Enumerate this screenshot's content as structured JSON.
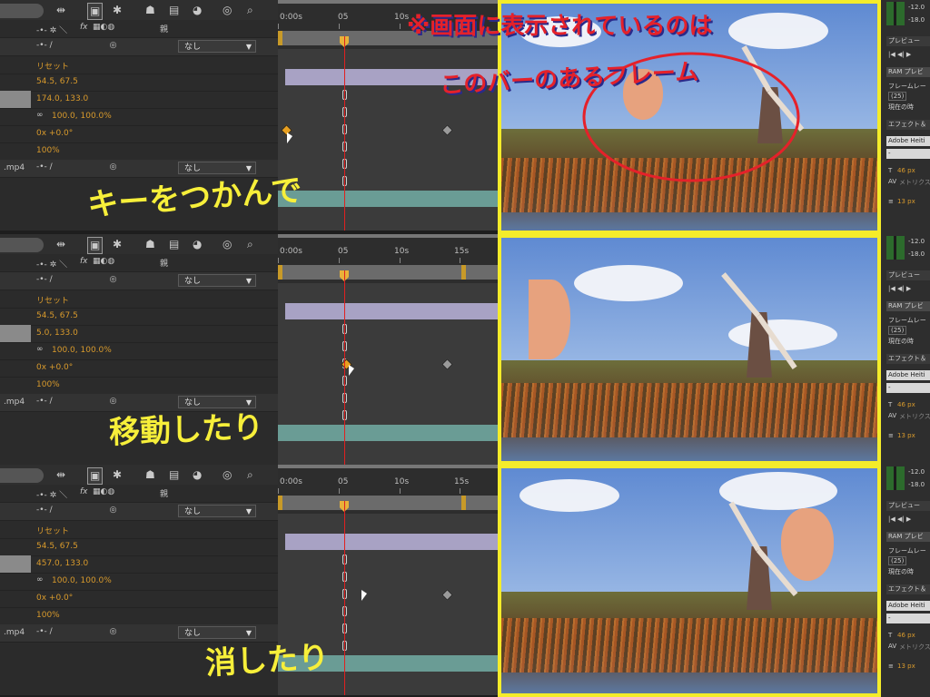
{
  "timeline": {
    "ruler_labels": [
      "0:00s",
      "05",
      "10s",
      "15s"
    ],
    "switches_label": "fx",
    "parent_header": "親",
    "parent_none": "なし",
    "reset_label": "リセット",
    "anchor_value": "54.5, 67.5",
    "rotation_value": "0x +0.0°",
    "opacity_value": "100%",
    "scale_value": "100.0, 100.0%",
    "layer_name": ".mp4",
    "panels": [
      {
        "position_value": "174.0, 133.0",
        "annotation": "キーをつかんで"
      },
      {
        "position_value": "5.0, 133.0",
        "annotation": "移動したり"
      },
      {
        "position_value": "457.0, 133.0",
        "annotation": "消したり"
      }
    ]
  },
  "viewer": {
    "annotation_line1": "※画面に表示されているのは",
    "annotation_line2": "このバーのあるフレーム"
  },
  "side_panel": {
    "db_labels": [
      "-12.0",
      "-18.0"
    ],
    "preview_label": "プレビュー",
    "ram_preview": "RAM プレビ",
    "frame_rate": "フレームレー",
    "fps": "(25)",
    "current_time": "現在の時",
    "effects_label": "エフェクト＆",
    "font_name": "Adobe Heiti",
    "font_style": "-",
    "size_value": "46 px",
    "tracking_label": "メトリクス",
    "px_value": "13 px"
  },
  "colors": {
    "accent_orange": "#d89a2c",
    "highlight_yellow": "#f4ec2a",
    "annotation_red": "#e5212a",
    "current_time_red": "#e02020"
  }
}
